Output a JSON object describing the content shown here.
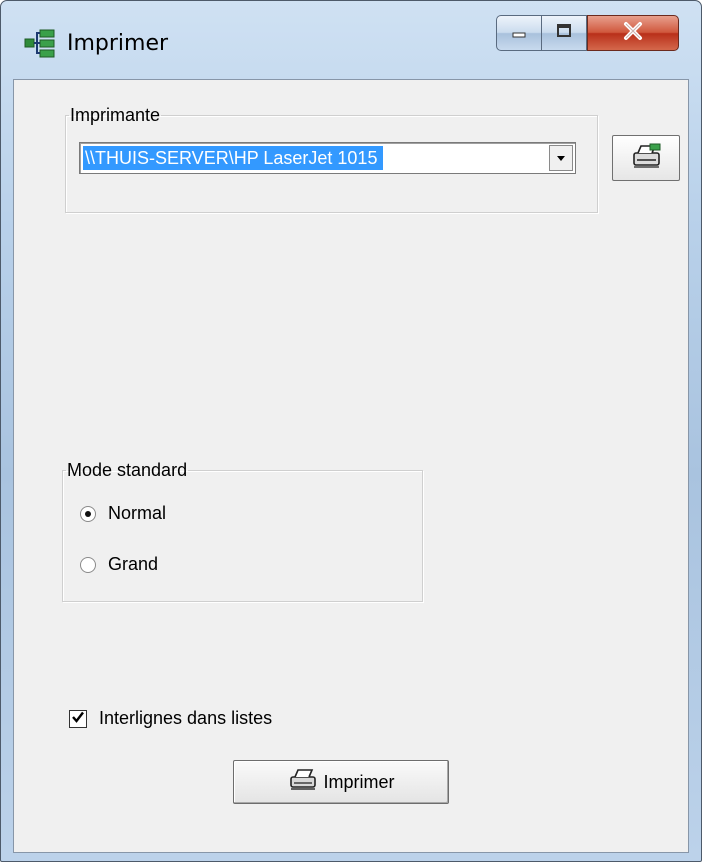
{
  "window": {
    "title": "Imprimer",
    "icons": {
      "app": "tree-network-icon",
      "minimize": "minimize-icon",
      "maximize": "maximize-icon",
      "close": "close-icon"
    },
    "colors": {
      "close_button": "#c7402a",
      "selection": "#3399ff",
      "dialog_bg": "#f0f0f0"
    }
  },
  "printer_group": {
    "legend": "Imprimante",
    "selected_printer": "\\\\THUIS-SERVER\\HP LaserJet 1015",
    "dropdown_icon": "chevron-down-icon",
    "setup_button_icon": "printer-setup-icon"
  },
  "mode_group": {
    "legend": "Mode standard",
    "options": [
      {
        "label": "Normal",
        "checked": true
      },
      {
        "label": "Grand",
        "checked": false
      }
    ]
  },
  "line_spacing": {
    "label": "Interlignes dans listes",
    "checked": true
  },
  "print_button": {
    "label": "Imprimer",
    "icon": "printer-icon"
  }
}
